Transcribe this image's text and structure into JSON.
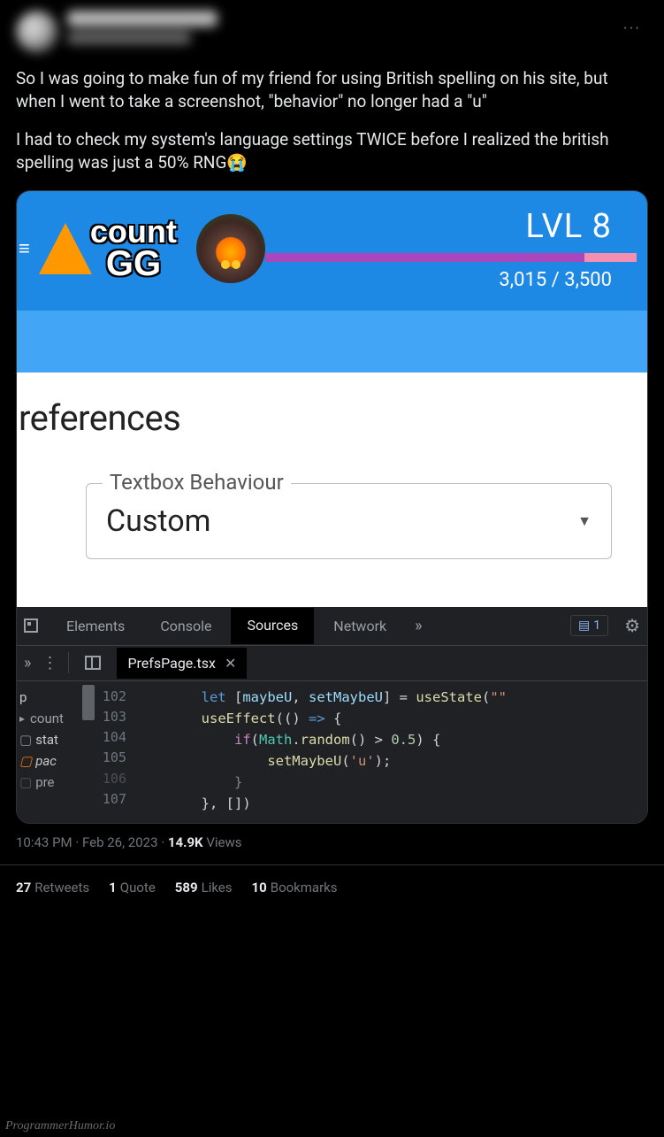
{
  "tweet": {
    "more_label": "···",
    "para1": "So I was going to make fun of my friend for using British spelling on his site, but when I went to take a screenshot, \"behavior\" no longer had a \"u\"",
    "para2": "I had to check my system's language settings TWICE before I realized the british spelling was just a 50% RNG😭",
    "timestamp": "10:43 PM",
    "date": "Feb 26, 2023",
    "views_count": "14.9K",
    "views_label": "Views",
    "stats": {
      "retweets_n": "27",
      "retweets_l": "Retweets",
      "quotes_n": "1",
      "quotes_l": "Quote",
      "likes_n": "589",
      "likes_l": "Likes",
      "bookmarks_n": "10",
      "bookmarks_l": "Bookmarks"
    }
  },
  "countgg": {
    "logo_line1": "count",
    "logo_line2": "GG",
    "level_label": "LVL 8",
    "xp": "3,015 / 3,500",
    "prefs_title": "references",
    "legend": "Textbox Behaviour",
    "select_value": "Custom"
  },
  "devtools": {
    "tabs": {
      "elements": "Elements",
      "console": "Console",
      "sources": "Sources",
      "network": "Network"
    },
    "issue_count": "1",
    "file_name": "PrefsPage.tsx",
    "side": {
      "r0": "p",
      "r1": "count",
      "r2": "stat",
      "r3": "pac",
      "r4": "pre"
    },
    "gutter": [
      "102",
      "103",
      "104",
      "105",
      "106",
      "107"
    ],
    "code": {
      "l102a": "let",
      "l102b": " [",
      "l102c": "maybeU",
      "l102d": ", ",
      "l102e": "setMaybeU",
      "l102f": "] = ",
      "l102g": "useState",
      "l102h": "(",
      "l102i": "\"\"",
      "l103a": "useEffect",
      "l103b": "(() ",
      "l103c": "=>",
      "l103d": " {",
      "l104a": "if",
      "l104b": "(",
      "l104c": "Math",
      "l104d": ".",
      "l104e": "random",
      "l104f": "() > ",
      "l104g": "0.5",
      "l104h": ") {",
      "l105a": "setMaybeU",
      "l105b": "(",
      "l105c": "'u'",
      "l105d": ");",
      "l106": "}",
      "l107": "}, [])"
    }
  },
  "watermark": "ProgrammerHumor.io"
}
